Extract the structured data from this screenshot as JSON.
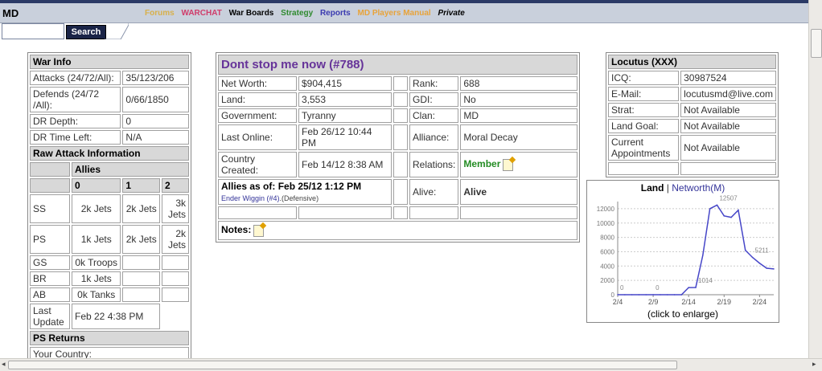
{
  "header": {
    "brand": "MD",
    "nav": [
      {
        "label": "Forums",
        "color": "#d8b04a"
      },
      {
        "label": "WARCHAT",
        "color": "#d03c6a"
      },
      {
        "label": "War Boards",
        "color": "#000000"
      },
      {
        "label": "Strategy",
        "color": "#2f8a2f"
      },
      {
        "label": "Reports",
        "color": "#3a3ab0"
      },
      {
        "label": "MD Players Manual",
        "color": "#e8a33a"
      },
      {
        "label": "Private",
        "color": "#000000"
      }
    ],
    "search_button": "Search",
    "search_value": ""
  },
  "war_info": {
    "title": "War Info",
    "attacks_label": "Attacks (24/72/All):",
    "attacks_value": "35/123/206",
    "defends_label": "Defends (24/72 /All):",
    "defends_value": "0/66/1850",
    "dr_depth_label": "DR Depth:",
    "dr_depth_value": "0",
    "dr_time_label": "DR Time Left:",
    "dr_time_value": "N/A",
    "raw_title": "Raw Attack Information",
    "allies_label": "Allies",
    "cols": [
      "0",
      "1",
      "2"
    ],
    "rows": [
      {
        "label": "SS",
        "values": [
          "2k Jets",
          "2k Jets",
          "3k Jets"
        ]
      },
      {
        "label": "PS",
        "values": [
          "1k Jets",
          "2k Jets",
          "2k Jets"
        ]
      },
      {
        "label": "GS",
        "values": [
          "0k Troops",
          "",
          ""
        ]
      },
      {
        "label": "BR",
        "values": [
          "1k Jets",
          "",
          ""
        ]
      },
      {
        "label": "AB",
        "values": [
          "0k Tanks",
          "",
          ""
        ]
      }
    ],
    "last_update_label": "Last Update",
    "last_update_value": "Feb 22 4:38 PM",
    "ps_returns": "PS Returns",
    "your_country": "Your Country:"
  },
  "country": {
    "name": "Dont stop me now (#788)",
    "networth_label": "Net Worth:",
    "networth": "$904,415",
    "land_label": "Land:",
    "land": "3,553",
    "gov_label": "Government:",
    "gov": "Tyranny",
    "online_label": "Last Online:",
    "online": "Feb 26/12 10:44 PM",
    "created_label": "Country Created:",
    "created": "Feb 14/12 8:38 AM",
    "rank_label": "Rank:",
    "rank": "688",
    "gdi_label": "GDI:",
    "gdi": "No",
    "clan_label": "Clan:",
    "clan": "MD",
    "alliance_label": "Alliance:",
    "alliance": "Moral Decay",
    "relations_label": "Relations:",
    "relations": "Member",
    "alive_label": "Alive:",
    "alive": "Alive",
    "allies_as_of": "Allies as of: Feb 25/12 1:12 PM",
    "ally_link": "Ender Wiggin (#4)",
    "ally_note": ".(Defensive)",
    "notes_label": "Notes:"
  },
  "player": {
    "title": "Locutus (XXX)",
    "icq_label": "ICQ:",
    "icq": "30987524",
    "email_label": "E-Mail:",
    "email": "locutusmd@live.com",
    "strat_label": "Strat:",
    "strat": "Not Available",
    "landgoal_label": "Land Goal:",
    "landgoal": "Not Available",
    "appointments_label": "Current Appointments",
    "appointments": "Not Available"
  },
  "chart": {
    "land_label": "Land",
    "sep": "|",
    "networth_label": "Networth(M)",
    "caption": "(click to enlarge)"
  },
  "chart_data": {
    "type": "line",
    "x": [
      "2/4",
      "2/5",
      "2/6",
      "2/7",
      "2/8",
      "2/9",
      "2/10",
      "2/11",
      "2/12",
      "2/13",
      "2/14",
      "2/15",
      "2/16",
      "2/17",
      "2/18",
      "2/19",
      "2/20",
      "2/21",
      "2/22",
      "2/23",
      "2/24",
      "2/25",
      "2/26"
    ],
    "values": [
      0,
      0,
      0,
      0,
      0,
      0,
      0,
      0,
      0,
      0,
      1000,
      1014,
      5500,
      12000,
      12507,
      11000,
      10800,
      11800,
      6200,
      5211,
      4400,
      3700,
      3600
    ],
    "xticks": [
      "2/4",
      "2/9",
      "2/14",
      "2/19",
      "2/24"
    ],
    "yticks": [
      "0",
      "2000",
      "4000",
      "6000",
      "8000",
      "10000",
      "12000"
    ],
    "ylim": [
      0,
      13000
    ],
    "annotations": [
      "0",
      "0",
      "1014",
      "12507",
      "5211"
    ],
    "line_color": "#4646c8",
    "grid": true
  }
}
